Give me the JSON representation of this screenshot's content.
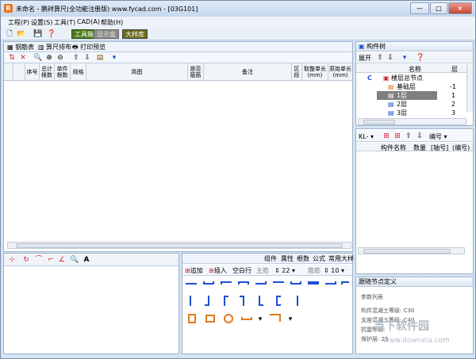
{
  "window": {
    "title": "未命名 - 鹏祥算尺(全功能注册版) www.fycad.com - [03G101]",
    "controls": [
      "—",
      "□",
      "×"
    ]
  },
  "menu": [
    "工程(P)",
    "设置(S)",
    "工具(T)",
    "CAD(A)",
    "帮助(H)"
  ],
  "toolbar": {
    "btn_toolbox": "工具箱",
    "btn_display_box": "显示盒",
    "btn_rebar_lib": "大样库"
  },
  "tabs": {
    "rebar_table": "钢筋表",
    "calc_arrange": "算尺排布",
    "print_preview": "打印预览"
  },
  "table_headers": [
    "序号",
    "总计根数",
    "单件根数",
    "规格",
    "简图",
    "是否箍筋",
    "备注",
    "区段",
    "取整单长(mm)",
    "原始单长(mm)"
  ],
  "bottom_tabs": [
    "组件",
    "属性",
    "根数",
    "公式",
    "常用大样"
  ],
  "bottom_tool": {
    "add": "追加",
    "insert": "插入",
    "blank_row": "空白行",
    "main_rebar": "主筋",
    "size": "22",
    "stirrup": "箍筋",
    "size2": "10"
  },
  "component_tree": {
    "title": "构件树",
    "expand": "展开",
    "col_name": "名称",
    "col_floor": "层",
    "rows": [
      {
        "label": "C",
        "name": "楼层总节点",
        "floor": ""
      },
      {
        "name": "基础层",
        "floor": "-1"
      },
      {
        "name": "1层",
        "floor": "1"
      },
      {
        "name": "2层",
        "floor": "2"
      },
      {
        "name": "3层",
        "floor": "3"
      }
    ]
  },
  "component_list": {
    "filter": "KL-",
    "numbering": "编号",
    "col_name": "构件名称",
    "col_count": "数量",
    "col_axis": "[轴号]",
    "col_no": "(编号)"
  },
  "node_def": {
    "title": "跟随节点定义",
    "param_list": "参数列表",
    "lines": [
      "构件混凝土等级: C30",
      "支座混凝土等级: C40",
      "抗震等级:",
      "保护层: 25"
    ]
  },
  "watermark": {
    "text": "当下软件园",
    "url": "www.downxia.com"
  },
  "colors": {
    "accent_blue": "#1c4fd1",
    "green_button": "#4b7a1c",
    "selected_row": "#7f7f7f"
  }
}
